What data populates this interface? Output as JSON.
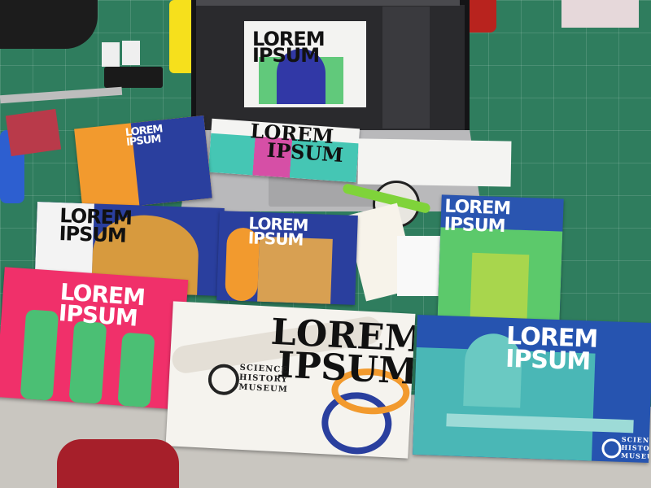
{
  "screen": {
    "title": "LOREM\nIPSUM"
  },
  "posters": [
    {
      "line1": "LOREM",
      "line2": "IPSUM"
    },
    {
      "line1": "LOREM",
      "line2": "IPSUM"
    },
    {
      "line1": "LOREM",
      "line2": "IPSUM"
    },
    {
      "line1": "LOREM",
      "line2": "IPSUM"
    },
    {
      "line1": "LOREM",
      "line2": "IPSUM"
    },
    {
      "line1": "LOREM",
      "line2": "IPSUM"
    },
    {
      "line1": "LOREM",
      "line2": "IPSUM"
    }
  ],
  "museum": {
    "line1": "SCIENCE",
    "line2": "HISTORY",
    "line3": "MUSEUM"
  },
  "colors": {
    "mat": "#2f7d5e",
    "orange": "#f29a2e",
    "navy": "#2a3f9e",
    "teal": "#45c6b4",
    "pink": "#f0306a",
    "lime": "#9bd33a"
  }
}
